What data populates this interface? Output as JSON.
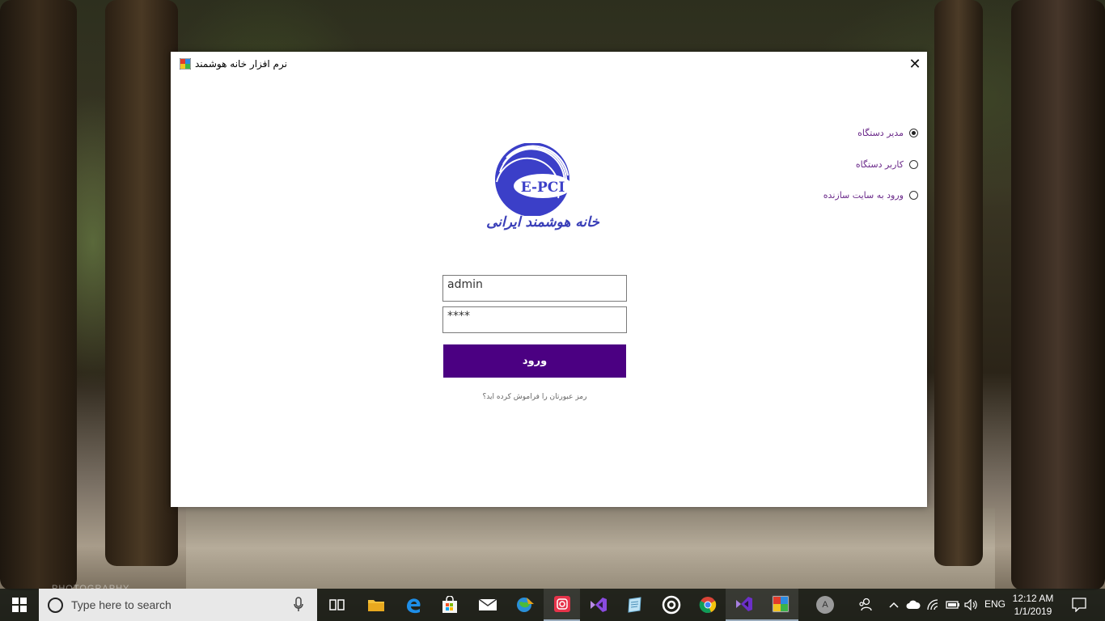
{
  "window": {
    "title": "نرم افزار خانه هوشمند",
    "close_symbol": "✕"
  },
  "radio_options": [
    {
      "label": "مدیر دستگاه",
      "checked": true
    },
    {
      "label": "کاربر دستگاه",
      "checked": false
    },
    {
      "label": "ورود به سایت سازنده",
      "checked": false
    }
  ],
  "logo": {
    "brand_text": "E-PCI",
    "tagline": "خانه هوشمند ایرانی",
    "color": "#3b3fc8"
  },
  "form": {
    "username_value": "admin",
    "password_value": "****",
    "login_label": "ورود",
    "forgot_label": "رمز عبورتان را فراموش کرده اید؟",
    "button_color": "#4b0082"
  },
  "taskbar": {
    "search_placeholder": "Type here to search",
    "avatar_letter": "A",
    "language": "ENG",
    "time": "12:12 AM",
    "date": "1/1/2019",
    "icons": [
      "task-view-icon",
      "file-explorer-icon",
      "edge-icon",
      "store-icon",
      "mail-icon",
      "earth-app-icon",
      "instagram-icon",
      "visual-studio-icon",
      "notepad-icon",
      "groove-icon",
      "chrome-icon",
      "visual-studio-alt-icon",
      "smart-home-app-icon"
    ]
  },
  "desktop": {
    "watermark": "PHOTOGRAPHY"
  }
}
